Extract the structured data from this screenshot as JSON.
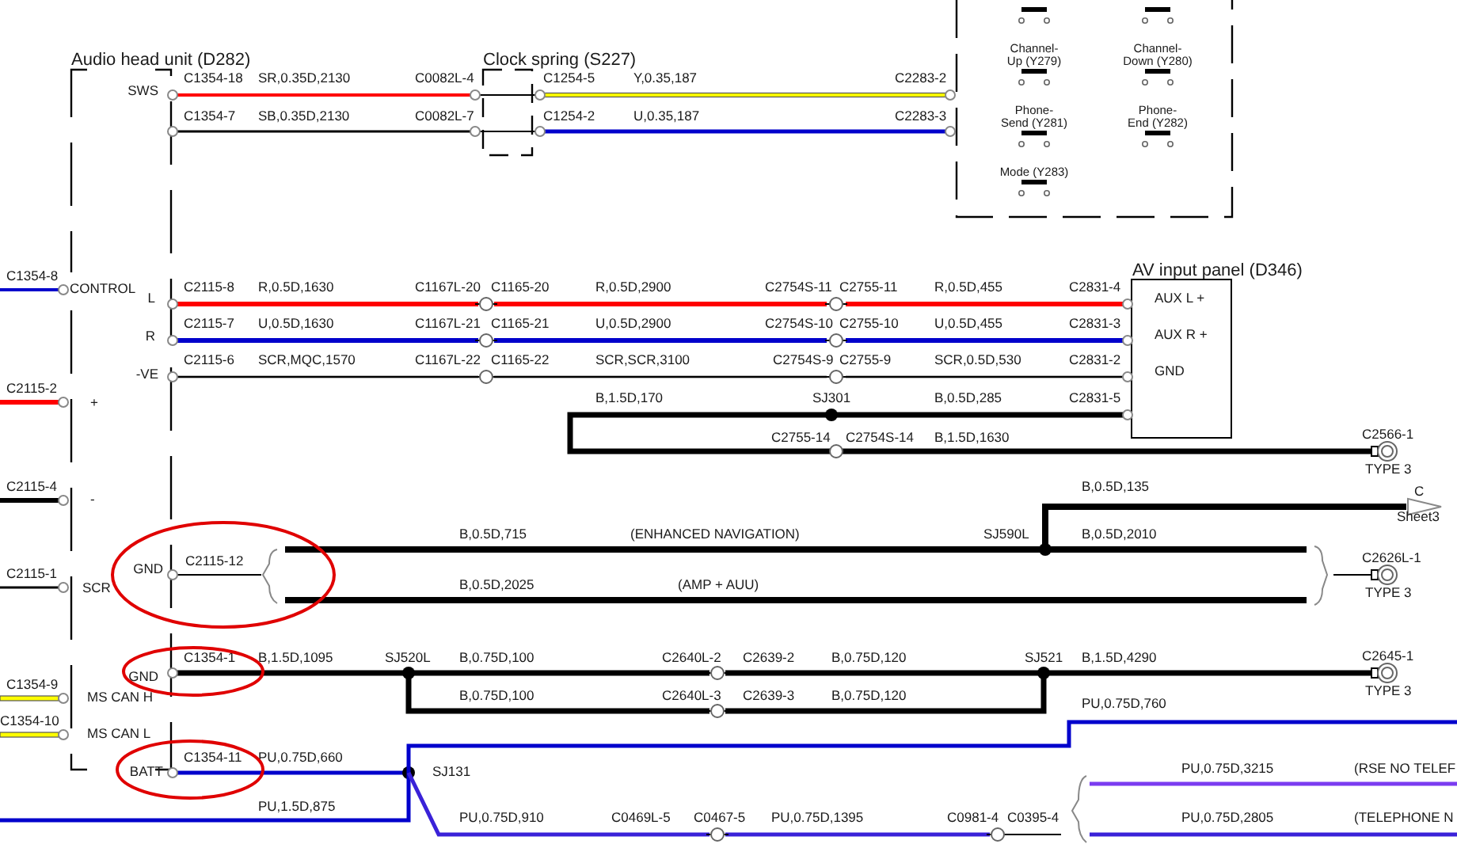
{
  "components": [
    {
      "title": "Audio head unit (D282)",
      "pins": [
        "SWS",
        "CONTROL",
        "L",
        "R",
        "-VE",
        "+",
        "-",
        "SCR",
        "GND",
        "GND",
        "MS CAN H",
        "MS CAN L",
        "BATT"
      ]
    },
    {
      "title": "Clock spring (S227)"
    },
    {
      "title": "AV input panel (D346)",
      "pins": [
        "AUX L +",
        "AUX R +",
        "GND"
      ]
    }
  ],
  "switches": [
    {
      "label_lines": [
        "Channel-",
        "Up (Y279)"
      ]
    },
    {
      "label_lines": [
        "Channel-",
        "Down (Y280)"
      ]
    },
    {
      "label_lines": [
        "Phone-",
        "Send (Y281)"
      ]
    },
    {
      "label_lines": [
        "Phone-",
        "End (Y282)"
      ]
    },
    {
      "label_lines": [
        "Mode (Y283)"
      ]
    }
  ],
  "wires": [
    {
      "color": "#ff0000",
      "labels": [
        "C1354-18",
        "SR,0.35D,2130",
        "C0082L-4"
      ]
    },
    {
      "color": "#000000",
      "labels": [
        "C1354-7",
        "SB,0.35D,2130",
        "C0082L-7"
      ]
    },
    {
      "color": "#ffff00",
      "labels": [
        "C1254-5",
        "Y,0.35,187",
        "C2283-2"
      ]
    },
    {
      "color": "#0000cc",
      "labels": [
        "C1254-2",
        "U,0.35,187",
        "C2283-3"
      ]
    },
    {
      "color": "#0000cc",
      "labels": [
        "C1354-8"
      ]
    },
    {
      "color": "#ff0000",
      "labels": [
        "C2115-8",
        "R,0.5D,1630",
        "C1167L-20",
        "C1165-20",
        "R,0.5D,2900",
        "C2754S-11",
        "C2755-11",
        "R,0.5D,455",
        "C2831-4"
      ]
    },
    {
      "color": "#0000cc",
      "labels": [
        "C2115-7",
        "U,0.5D,1630",
        "C1167L-21",
        "C1165-21",
        "U,0.5D,2900",
        "C2754S-10",
        "C2755-10",
        "U,0.5D,455",
        "C2831-3"
      ]
    },
    {
      "color": "#000000",
      "labels": [
        "C2115-6",
        "SCR,MQC,1570",
        "C1167L-22",
        "C1165-22",
        "SCR,SCR,3100",
        "C2754S-9",
        "C2755-9",
        "SCR,0.5D,530",
        "C2831-2"
      ]
    },
    {
      "color": "#ff0000",
      "labels": [
        "C2115-2"
      ]
    },
    {
      "color": "#000000",
      "labels": [
        "B,1.5D,170",
        "SJ301",
        "B,0.5D,285",
        "C2831-5",
        "C2755-14",
        "C2754S-14",
        "B,1.5D,1630"
      ]
    },
    {
      "color": "#000000",
      "labels": [
        "C2115-4"
      ]
    },
    {
      "color": "#000000",
      "labels": [
        "C2115-12"
      ]
    },
    {
      "color": "#000000",
      "labels": [
        "B,0.5D,135"
      ]
    },
    {
      "color": "#000000",
      "labels": [
        "B,0.5D,715",
        "(ENHANCED NAVIGATION)",
        "SJ590L",
        "B,0.5D,2010"
      ]
    },
    {
      "color": "#000000",
      "labels": [
        "B,0.5D,2025",
        "(AMP + AUU)"
      ]
    },
    {
      "color": "#000000",
      "labels": [
        "C2115-1"
      ]
    },
    {
      "color": "#000000",
      "labels": [
        "C1354-1",
        "B,1.5D,1095",
        "SJ520L",
        "B,0.75D,100",
        "C2640L-2",
        "C2639-2",
        "B,0.75D,120",
        "SJ521",
        "B,1.5D,4290"
      ]
    },
    {
      "color": "#000000",
      "labels": [
        "B,0.75D,100",
        "C2640L-3",
        "C2639-3",
        "B,0.75D,120"
      ]
    },
    {
      "color": "#ffff00",
      "labels": [
        "C1354-9"
      ]
    },
    {
      "color": "#ffff00",
      "labels": [
        "C1354-10"
      ]
    },
    {
      "color": "#0000cc",
      "labels": [
        "C1354-11",
        "PU,0.75D,660",
        "SJ131"
      ]
    },
    {
      "color": "#0000cc",
      "labels": [
        "PU,1.5D,875",
        "PU,0.75D,760"
      ]
    },
    {
      "color": "#3a22d8",
      "labels": [
        "PU,0.75D,910",
        "C0469L-5",
        "C0467-5",
        "PU,0.75D,1395",
        "C0981-4",
        "C0395-4"
      ]
    },
    {
      "color": "#7b3cf0",
      "labels": [
        "PU,0.75D,3215",
        "(RSE NO TELEF"
      ]
    },
    {
      "color": "#3a22d8",
      "labels": [
        "PU,0.75D,2805",
        "(TELEPHONE N"
      ]
    }
  ],
  "ground_terminals": [
    {
      "connector": "C2566-1",
      "type": "TYPE 3"
    },
    {
      "connector": "C2626L-1",
      "type": "TYPE 3"
    },
    {
      "connector": "C2645-1",
      "type": "TYPE 3"
    }
  ],
  "sheet_reference": {
    "letter": "C",
    "sheet": "Sheet3"
  }
}
